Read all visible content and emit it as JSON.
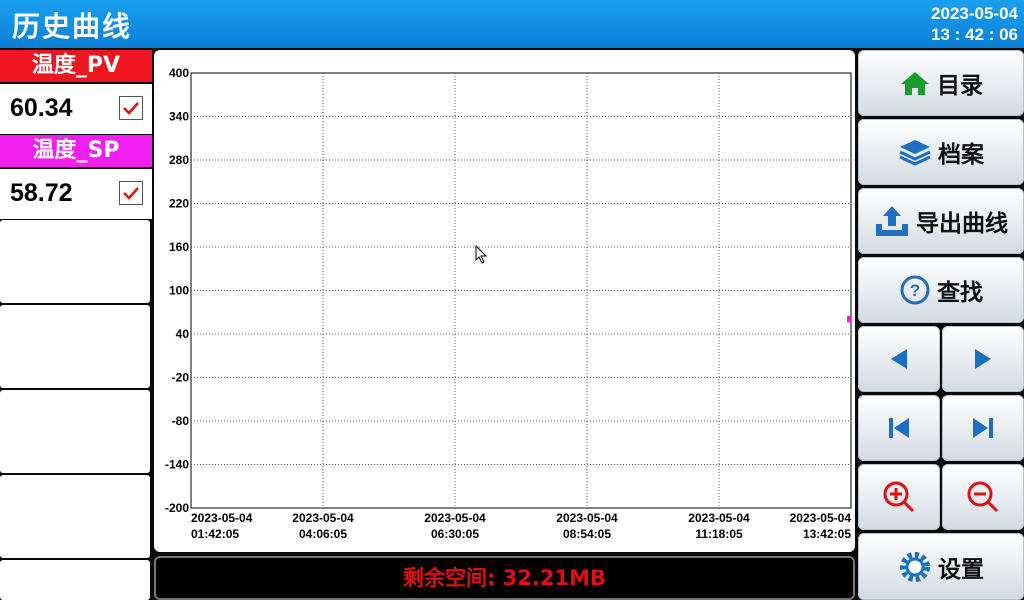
{
  "header": {
    "title": "历史曲线",
    "date": "2023-05-04",
    "time": "13 : 42 : 06"
  },
  "channels": [
    {
      "name": "温度_PV",
      "value": "60.34",
      "color": "#f0141e",
      "checked": true
    },
    {
      "name": "温度_SP",
      "value": "58.72",
      "color": "#f01ef0",
      "checked": true
    }
  ],
  "chart_data": {
    "type": "line",
    "ylim": [
      -200,
      400
    ],
    "y_ticks": [
      "400",
      "340",
      "280",
      "220",
      "160",
      "100",
      "40",
      "-20",
      "-80",
      "-140",
      "-200"
    ],
    "x_ticks": [
      {
        "date": "2023-05-04",
        "time": "01:42:05"
      },
      {
        "date": "2023-05-04",
        "time": "04:06:05"
      },
      {
        "date": "2023-05-04",
        "time": "06:30:05"
      },
      {
        "date": "2023-05-04",
        "time": "08:54:05"
      },
      {
        "date": "2023-05-04",
        "time": "11:18:05"
      },
      {
        "date": "2023-05-04",
        "time": "13:42:05"
      }
    ],
    "series": [
      {
        "name": "温度_PV",
        "color": "#f0141e",
        "values": [
          60.34
        ]
      },
      {
        "name": "温度_SP",
        "color": "#f01ef0",
        "values": [
          58.72
        ]
      }
    ],
    "grid": true
  },
  "footer": {
    "storage": "剩余空间: 32.21MB"
  },
  "buttons": {
    "menu": "目录",
    "archive": "档案",
    "export": "导出曲线",
    "search": "查找",
    "settings": "设置"
  }
}
